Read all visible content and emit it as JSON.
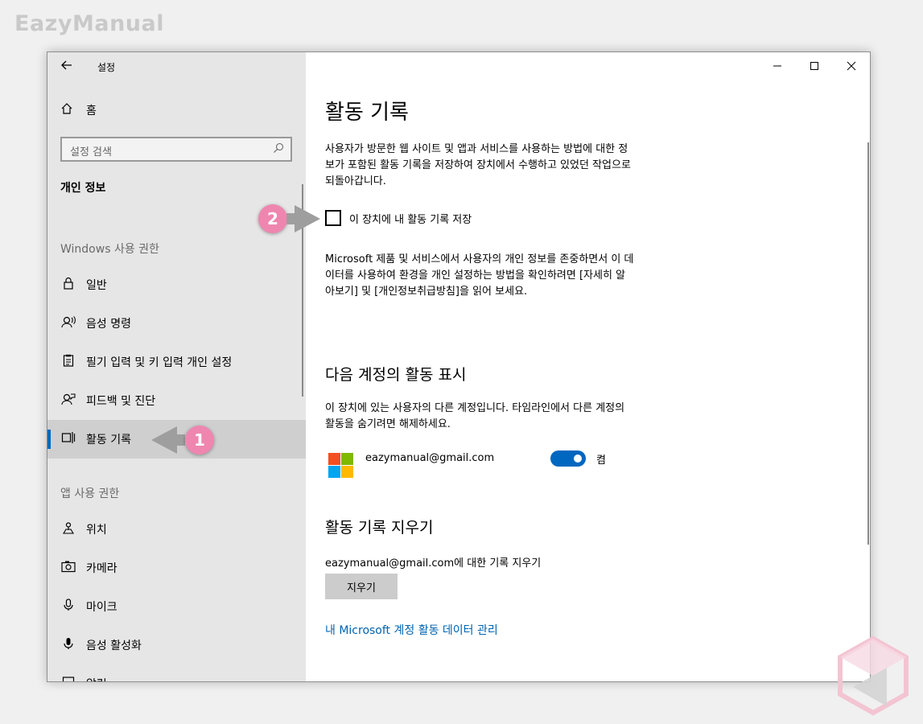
{
  "brand": "EazyManual",
  "window": {
    "title": "설정",
    "back_icon": "back-arrow-icon",
    "controls": {
      "minimize": "—",
      "maximize": "☐",
      "close": "✕"
    }
  },
  "sidebar": {
    "home_label": "홈",
    "search_placeholder": "설정 검색",
    "section_title": "개인 정보",
    "group_windows": "Windows 사용 권한",
    "windows_items": [
      {
        "label": "일반",
        "icon": "lock-icon"
      },
      {
        "label": "음성 명령",
        "icon": "speech-icon"
      },
      {
        "label": "필기 입력 및 키 입력 개인 설정",
        "icon": "clipboard-icon"
      },
      {
        "label": "피드백 및 진단",
        "icon": "feedback-icon"
      },
      {
        "label": "활동 기록",
        "icon": "timeline-icon",
        "selected": true
      }
    ],
    "group_apps": "앱 사용 권한",
    "app_items": [
      {
        "label": "위치",
        "icon": "location-icon"
      },
      {
        "label": "카메라",
        "icon": "camera-icon"
      },
      {
        "label": "마이크",
        "icon": "microphone-icon"
      },
      {
        "label": "음성 활성화",
        "icon": "voice-activation-icon"
      },
      {
        "label": "알림",
        "icon": "notification-icon"
      }
    ]
  },
  "main": {
    "title": "활동 기록",
    "intro_lines": [
      "사용자가 방문한 웹 사이트 및 앱과 서비스를 사용하는 방법에 대한 정",
      "보가 포함된 활동 기록을 저장하여 장치에서 수행하고 있었던 작업으로",
      "되돌아갑니다."
    ],
    "store_checkbox_label": "이 장치에 내 활동 기록 저장",
    "store_checked": false,
    "privacy_lines": [
      "Microsoft 제품 및 서비스에서 사용자의 개인 정보를 존중하면서 이 데",
      "이터를 사용하여 환경을 개인 설정하는 방법을 확인하려면 [자세히 알",
      "아보기] 및 [개인정보취급방침]을 읽어 보세요."
    ],
    "accounts_heading": "다음 계정의 활동 표시",
    "accounts_desc_lines": [
      "이 장치에 있는 사용자의 다른 계정입니다. 타임라인에서 다른 계정의",
      "활동을 숨기려면 해제하세요."
    ],
    "account_email": "eazymanual@gmail.com",
    "toggle_label": "켬",
    "toggle_on": true,
    "clear_heading": "활동 기록 지우기",
    "clear_label": "eazymanual@gmail.com에 대한 기록 지우기",
    "clear_button": "지우기",
    "manage_link": "내 Microsoft 계정 활동 데이터 관리"
  },
  "annotations": {
    "badge1": "1",
    "badge2": "2"
  },
  "colors": {
    "accent": "#0067c0",
    "badge": "#ee86b0",
    "link": "#0063b1",
    "ms_red": "#f25022",
    "ms_green": "#7fba00",
    "ms_blue": "#00a4ef",
    "ms_yellow": "#ffb900"
  }
}
